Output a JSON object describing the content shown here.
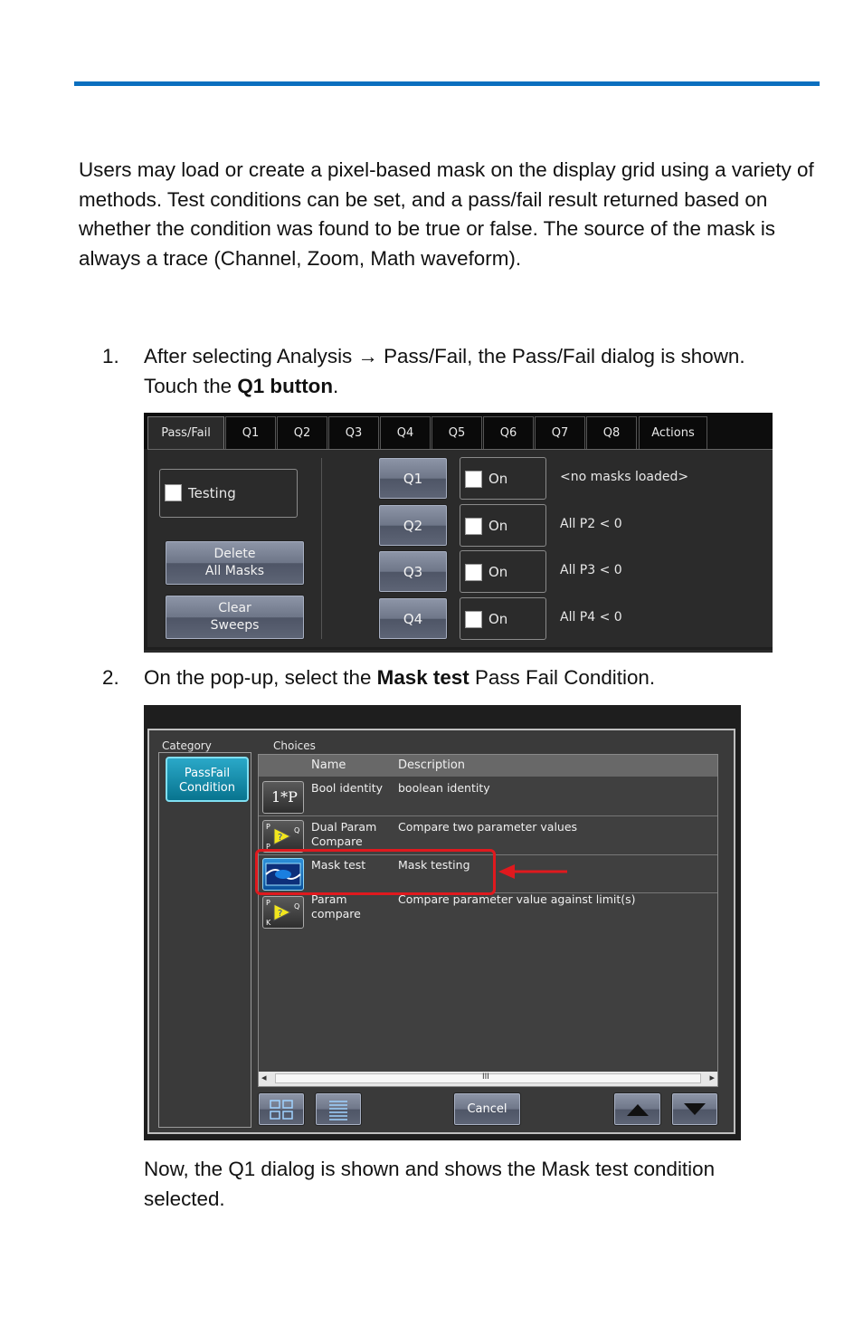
{
  "intro": "Users may load or create a pixel-based mask on the display grid using a variety of methods. Test conditions can be set, and a pass/fail result returned based on whether the condition was found to be true or false. The source of the mask is always a trace (Channel, Zoom, Math waveform).",
  "step1": {
    "num": "1.",
    "pre": "After selecting Analysis → Pass/Fail, the Pass/Fail dialog is shown. Touch the ",
    "bold": "Q1 button",
    "post": "."
  },
  "step2": {
    "num": "2.",
    "pre": "On the pop-up, select the ",
    "bold": "Mask test",
    "post": " Pass Fail Condition."
  },
  "after": "Now, the Q1 dialog is shown and shows the Mask test condition selected.",
  "passfail_dialog": {
    "tabs": [
      "Pass/Fail",
      "Q1",
      "Q2",
      "Q3",
      "Q4",
      "Q5",
      "Q6",
      "Q7",
      "Q8",
      "Actions"
    ],
    "testing_label": "Testing",
    "delete_btn": [
      "Delete",
      "All Masks"
    ],
    "clear_btn": [
      "Clear",
      "Sweeps"
    ],
    "qrows": [
      {
        "q": "Q1",
        "on": "On",
        "desc": "<no masks loaded>"
      },
      {
        "q": "Q2",
        "on": "On",
        "desc": "All P2 < 0"
      },
      {
        "q": "Q3",
        "on": "On",
        "desc": "All P3 < 0"
      },
      {
        "q": "Q4",
        "on": "On",
        "desc": "All P4 < 0"
      }
    ]
  },
  "condition_popup": {
    "category_label": "Category",
    "choices_label": "Choices",
    "category_button": [
      "PassFail",
      "Condition"
    ],
    "col_name": "Name",
    "col_desc": "Description",
    "rows": [
      {
        "name": [
          "Bool identity"
        ],
        "desc": "boolean identity",
        "icon": "bool-identity-icon"
      },
      {
        "name": [
          "Dual Param",
          "Compare"
        ],
        "desc": "Compare two parameter values",
        "icon": "dual-param-icon"
      },
      {
        "name": [
          "Mask test"
        ],
        "desc": "Mask testing",
        "icon": "mask-test-icon"
      },
      {
        "name": [
          "Param",
          "compare"
        ],
        "desc": "Compare parameter value against limit(s)",
        "icon": "param-compare-icon"
      }
    ],
    "bool_icon_text": "1*P",
    "scroll_mark": "III",
    "cancel": "Cancel"
  },
  "highlight_color": "#e0191e",
  "accent_color": "#0a6fbf"
}
